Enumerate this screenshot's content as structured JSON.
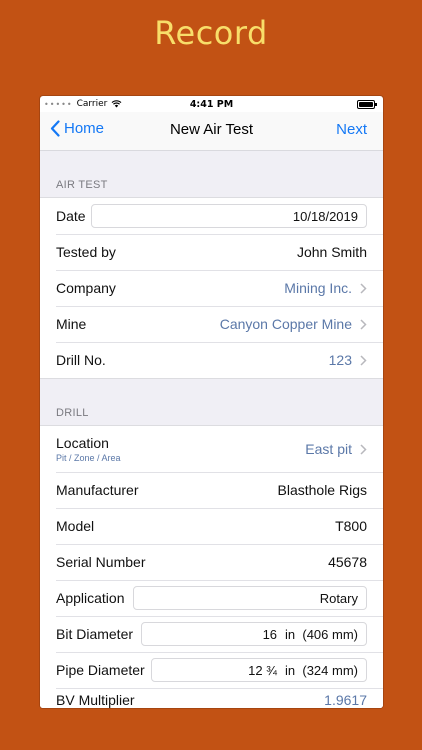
{
  "promo": {
    "title": "Record"
  },
  "status": {
    "carrier": "Carrier",
    "time": "4:41 PM"
  },
  "nav": {
    "back": "Home",
    "title": "New Air Test",
    "next": "Next"
  },
  "sections": {
    "air_test": {
      "header": "AIR TEST",
      "date_label": "Date",
      "date_value": "10/18/2019",
      "tested_by_label": "Tested by",
      "tested_by_value": "John Smith",
      "company_label": "Company",
      "company_value": "Mining Inc.",
      "mine_label": "Mine",
      "mine_value": "Canyon Copper Mine",
      "drill_no_label": "Drill No.",
      "drill_no_value": "123"
    },
    "drill": {
      "header": "DRILL",
      "location_label": "Location",
      "location_sub": "Pit / Zone / Area",
      "location_value": "East pit",
      "manufacturer_label": "Manufacturer",
      "manufacturer_value": "Blasthole Rigs",
      "model_label": "Model",
      "model_value": "T800",
      "serial_label": "Serial Number",
      "serial_value": "45678",
      "application_label": "Application",
      "application_value": "Rotary",
      "bit_label": "Bit Diameter",
      "bit_value": "16",
      "bit_unit": "in  (406 mm)",
      "pipe_label": "Pipe Diameter",
      "pipe_value": "12 ¾",
      "pipe_unit": "in  (324 mm)",
      "bv_label": "BV Multiplier",
      "bv_value": "1.9617"
    }
  },
  "colors": {
    "background": "#C25214",
    "promo_text": "#F8DE6A",
    "accent": "#1478F5",
    "link_value": "#5B78A8"
  }
}
